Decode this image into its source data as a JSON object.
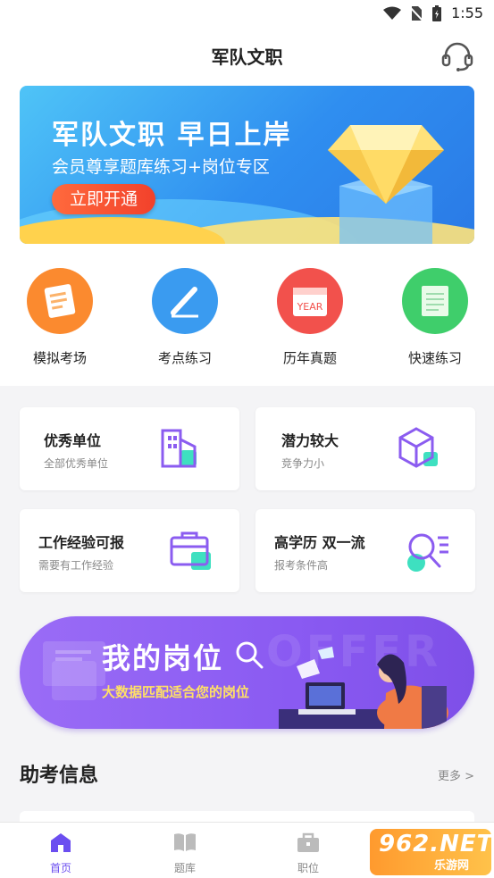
{
  "status_bar": {
    "time": "1:55"
  },
  "header": {
    "title": "军队文职"
  },
  "banner": {
    "title": "军队文职  早日上岸",
    "subtitle": "会员尊享题库练习+岗位专区",
    "button": "立即开通"
  },
  "quick_actions": [
    {
      "label": "模拟考场",
      "color": "#fb8a2f"
    },
    {
      "label": "考点练习",
      "color": "#3a9bf0"
    },
    {
      "label": "历年真题",
      "color": "#f2514c"
    },
    {
      "label": "快速练习",
      "color": "#3fce6b"
    }
  ],
  "cards": [
    {
      "title": "优秀单位",
      "subtitle": "全部优秀单位"
    },
    {
      "title": "潜力较大",
      "subtitle": "竞争力小"
    },
    {
      "title": "工作经验可报",
      "subtitle": "需要有工作经验"
    },
    {
      "title": "高学历 双一流",
      "subtitle": "报考条件高"
    }
  ],
  "my_positions": {
    "title": "我的岗位",
    "subtitle": "大数据匹配适合您的岗位",
    "background_word": "OFFER"
  },
  "info_section": {
    "title": "助考信息",
    "more": "更多 >"
  },
  "tabbar": [
    {
      "label": "首页",
      "active": true
    },
    {
      "label": "题库",
      "active": false
    },
    {
      "label": "职位",
      "active": false
    }
  ],
  "watermark": {
    "text": "962.NET",
    "sub": "乐游网"
  },
  "colors": {
    "accent": "#6b4ef0",
    "banner_blue": "#2f8ef0"
  }
}
